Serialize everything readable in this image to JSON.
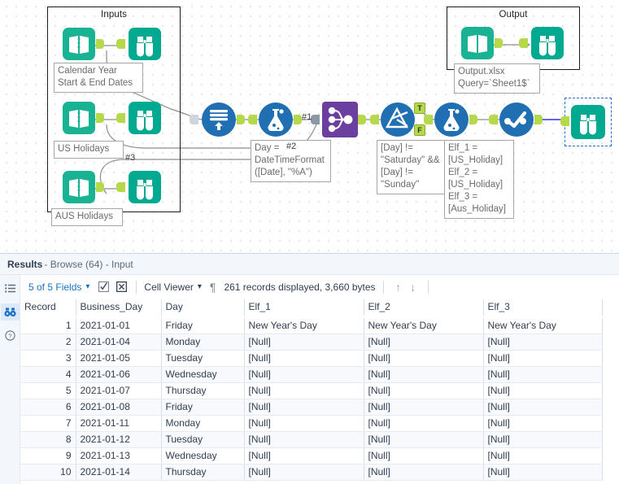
{
  "canvas": {
    "containers": [
      {
        "name": "inputs",
        "title": "Inputs"
      },
      {
        "name": "output",
        "title": "Output"
      }
    ],
    "annotations": [
      {
        "name": "calendar-year-annotation",
        "text": "Calendar Year\nStart & End Dates"
      },
      {
        "name": "us-holidays-annotation",
        "text": "US Holidays"
      },
      {
        "name": "aus-holidays-annotation",
        "text": "AUS Holidays"
      },
      {
        "name": "output-file-annotation",
        "text": "Output.xlsx\nQuery=`Sheet1$`"
      },
      {
        "name": "formula-day-annotation",
        "text": "Day =\nDateTimeFormat\n([Date], \"%A\")"
      },
      {
        "name": "filter-expression-annotation",
        "text": "[Day] !=\n\"Saturday\" &&\n[Day] !=\n\"Sunday\""
      },
      {
        "name": "elf-formula-annotation",
        "text": "Elf_1 =\n[US_Holiday]\nElf_2 =\n[US_Holiday]\nElf_3 =\n[Aus_Holiday]"
      }
    ],
    "connection_labels": [
      {
        "name": "connection-label-1",
        "text": "#1"
      },
      {
        "name": "connection-label-2",
        "text": "#2"
      },
      {
        "name": "connection-label-3",
        "text": "#3"
      }
    ],
    "filter_ports": {
      "true_label": "T",
      "false_label": "F"
    },
    "colors": {
      "input_tool": "#19b394",
      "browse_tool": "#00a98f",
      "blue_tool": "#1f6fb2",
      "join_tool": "#6b3fa0",
      "port_green": "#b5d94a",
      "selection": "#1f6fd0"
    }
  },
  "results": {
    "header": {
      "title": "Results",
      "subtitle": "- Browse (64) - Input"
    },
    "rail": [
      {
        "name": "list-icon",
        "active": false
      },
      {
        "name": "browse-binoculars-icon",
        "active": true
      },
      {
        "name": "help-icon",
        "active": false
      }
    ],
    "toolbar": {
      "fields_label": "5 of 5 Fields",
      "checkbox_icon": "checked-box-icon",
      "clear_icon": "clear-box-icon",
      "cell_viewer_label": "Cell Viewer",
      "pilcrow_icon": "¶",
      "record_status": "261 records displayed, 3,660 bytes",
      "arrow_up": "↑",
      "arrow_down": "↓"
    },
    "table": {
      "columns": [
        {
          "key": "record",
          "label": "Record",
          "underline": "none"
        },
        {
          "key": "business_day",
          "label": "Business_Day",
          "underline": "green"
        },
        {
          "key": "day",
          "label": "Day",
          "underline": "green"
        },
        {
          "key": "elf_1",
          "label": "Elf_1",
          "underline": "orange"
        },
        {
          "key": "elf_2",
          "label": "Elf_2",
          "underline": "orange"
        },
        {
          "key": "elf_3",
          "label": "Elf_3",
          "underline": "orange"
        }
      ],
      "null_text": "[Null]",
      "rows": [
        {
          "record": "1",
          "business_day": "2021-01-01",
          "day": "Friday",
          "elf_1": "New Year's Day",
          "elf_2": "New Year's Day",
          "elf_3": "New Year's Day"
        },
        {
          "record": "2",
          "business_day": "2021-01-04",
          "day": "Monday",
          "elf_1": "[Null]",
          "elf_2": "[Null]",
          "elf_3": "[Null]"
        },
        {
          "record": "3",
          "business_day": "2021-01-05",
          "day": "Tuesday",
          "elf_1": "[Null]",
          "elf_2": "[Null]",
          "elf_3": "[Null]"
        },
        {
          "record": "4",
          "business_day": "2021-01-06",
          "day": "Wednesday",
          "elf_1": "[Null]",
          "elf_2": "[Null]",
          "elf_3": "[Null]"
        },
        {
          "record": "5",
          "business_day": "2021-01-07",
          "day": "Thursday",
          "elf_1": "[Null]",
          "elf_2": "[Null]",
          "elf_3": "[Null]"
        },
        {
          "record": "6",
          "business_day": "2021-01-08",
          "day": "Friday",
          "elf_1": "[Null]",
          "elf_2": "[Null]",
          "elf_3": "[Null]"
        },
        {
          "record": "7",
          "business_day": "2021-01-11",
          "day": "Monday",
          "elf_1": "[Null]",
          "elf_2": "[Null]",
          "elf_3": "[Null]"
        },
        {
          "record": "8",
          "business_day": "2021-01-12",
          "day": "Tuesday",
          "elf_1": "[Null]",
          "elf_2": "[Null]",
          "elf_3": "[Null]"
        },
        {
          "record": "9",
          "business_day": "2021-01-13",
          "day": "Wednesday",
          "elf_1": "[Null]",
          "elf_2": "[Null]",
          "elf_3": "[Null]"
        },
        {
          "record": "10",
          "business_day": "2021-01-14",
          "day": "Thursday",
          "elf_1": "[Null]",
          "elf_2": "[Null]",
          "elf_3": "[Null]"
        }
      ]
    }
  }
}
